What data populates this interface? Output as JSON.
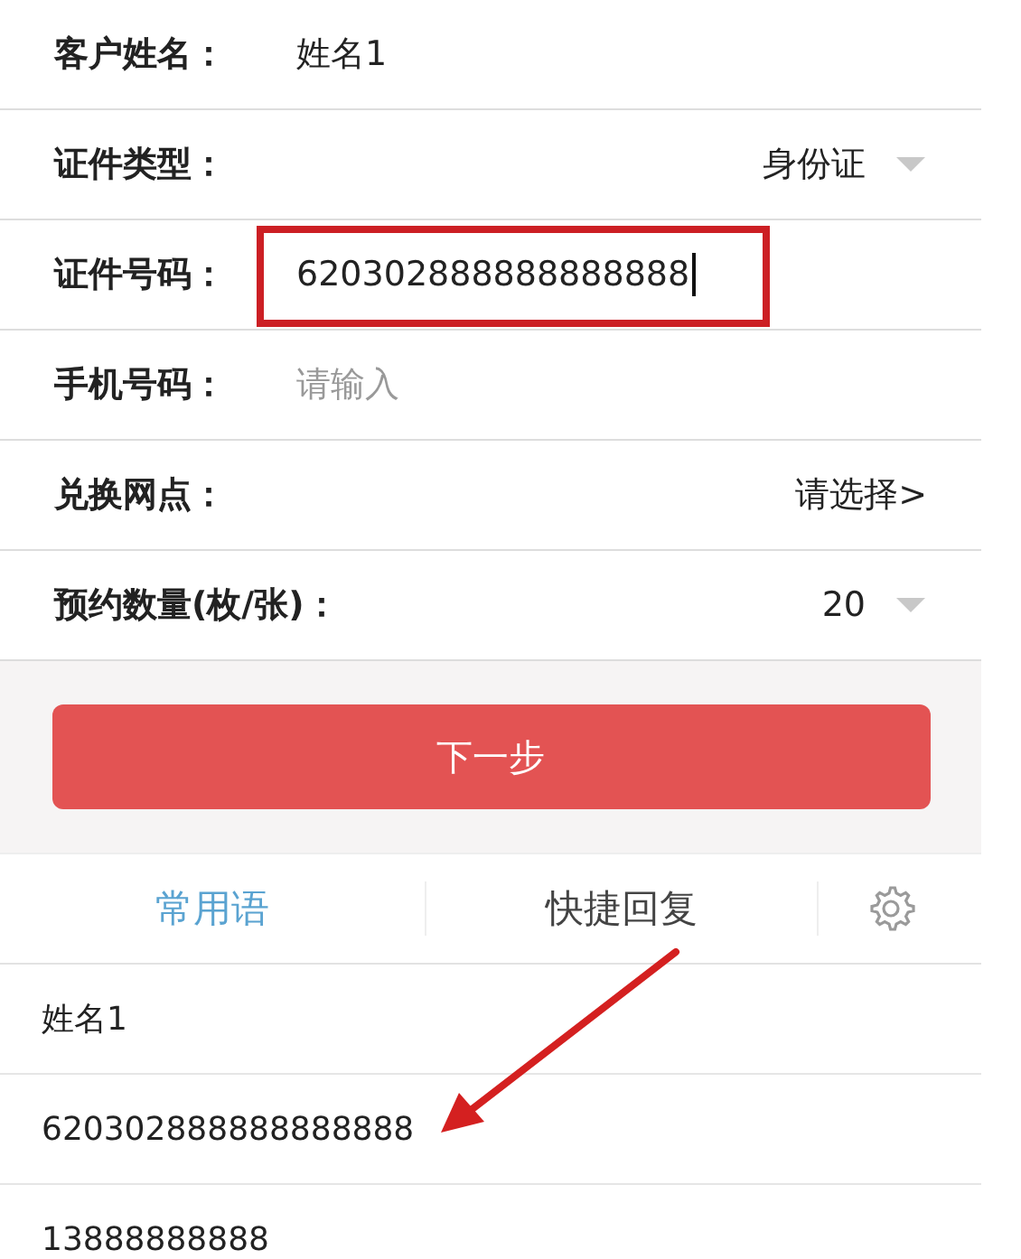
{
  "form": {
    "fields": [
      {
        "kind": "text",
        "label": "客户姓名：",
        "value": "姓名1"
      },
      {
        "kind": "dropdown",
        "label": "证件类型：",
        "value": "身份证"
      },
      {
        "kind": "input",
        "label": "证件号码：",
        "value": "620302888888888888",
        "focused": true,
        "highlighted": true
      },
      {
        "kind": "input",
        "label": "手机号码：",
        "placeholder": "请输入",
        "focused": false,
        "highlighted": false
      },
      {
        "kind": "link",
        "label": "兑换网点：",
        "value": "请选择>"
      },
      {
        "kind": "dropdown",
        "label": "预约数量(枚/张)：",
        "value": "20"
      }
    ]
  },
  "next_button": "下一步",
  "reply_tabs": [
    {
      "label": "常用语",
      "selected": true
    },
    {
      "label": "快捷回复",
      "selected": false
    }
  ],
  "phrases": [
    {
      "text": "姓名1",
      "pointed": false
    },
    {
      "text": "620302888888888888",
      "pointed": true
    },
    {
      "text": "13888888888",
      "pointed": false
    }
  ]
}
